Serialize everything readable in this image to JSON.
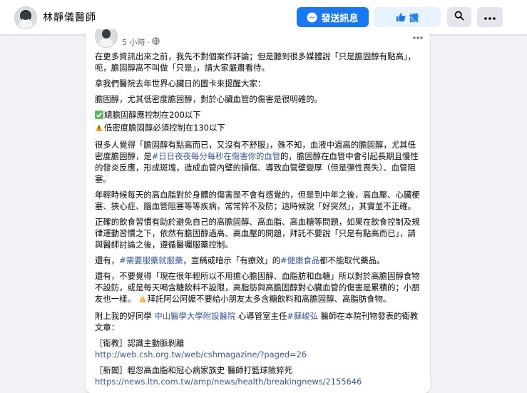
{
  "header": {
    "page_name": "林靜儀醫師",
    "message_label": "發送訊息",
    "like_label": "讚",
    "search_icon": "search-icon",
    "more_icon": "more-horizontal-icon"
  },
  "colors": {
    "accent": "#1877f2",
    "accent_light": "#e7f3ff",
    "link": "#385898",
    "background": "#f0f2f5"
  },
  "post": {
    "time": "5 小時",
    "dot": "·",
    "audience_icon": "globe-icon",
    "paragraphs": {
      "p1": "在更多資訊出來之前，我先不對個案作評論；但是聽到很多媒體說「只是膽固醇有點高」，呃，膽固醇高不叫做「只是」，請大家嚴肅看待。",
      "p2": "拿我們醫院去年世界心臟日的圖卡來提醒大家：",
      "p3": "膽固醇，尤其低密度膽固醇，對於心臟血管的傷害是很明確的。",
      "check1": "總膽固醇應控制在200以下",
      "check2": "低密度膽固醇必須控制在130以下",
      "p4a": "很多人覺得「膽固醇有點高而已，又沒有不舒服」，殊不知，血液中過高的膽固醇，尤其低密度膽固醇，是",
      "p4tag": "#日日夜夜每分每秒在傷害你的血管",
      "p4b": "的，膽固醇在血管中會引起長期且慢性的發炎反應，形成斑塊，造成血管內壁的損傷、導致血管壁變厚（但是彈性喪失）、血管阻塞。",
      "p5": "年輕時候每天的高血脂對於身體的傷害是不會有感覺的，但是到中年之後，高血壓、心臟梗塞、狹心症、腦血管阻塞等等疾病，常常猝不及防；這時候說「好突然」，其實並不正確。",
      "p6": "正確的飲食習慣有助於避免自己的高膽固醇、高血脂、高血糖等問題，如果在飲食控制及規律運動習慣之下，依然有膽固醇過高、高血壓的問題，拜託不要說「只是有點高而已」，請與醫師討論之後，遵循醫囑服藥控制。",
      "p7a": "還有，",
      "p7tag1": "#需要服藥就服藥",
      "p7b": "，宣稱或暗示「有療效」的",
      "p7tag2": "#健康食品",
      "p7c": "都不能取代藥品。",
      "p8a": "還有，不要覺得「現在很年輕所以不用擔心膽固醇、血脂肪和血糖」所以對於高膽固醇食物不設防，或是每天喝含糖飲料不設限，高脂肪與高膽固醇對心臟血管的傷害是累積的；小朋友也一樣。",
      "p8b": "拜託阿公阿嬤不要給小朋友太多含糖飲料和高膽固醇、高脂肪食物。",
      "p9a": "附上我的好同學",
      "p9link": "中山醫學大學附設醫院",
      "p9b": "心導管室主任",
      "p9tag": "#蘇峻弘",
      "p9c": "醫師在本院刊物發表的衛教文章：",
      "ref1_title": "［衛教］認識主動脈剝離",
      "ref1_url": "http://web.csh.org.tw/web/cshmagazine/?paged=26",
      "ref2_title": "［新聞］輕忽高血脂和冠心病家族史 醫師打籃球險猝死",
      "ref2_url": "https://news.ltn.com.tw/amp/news/health/breakingnews/2155646"
    }
  }
}
